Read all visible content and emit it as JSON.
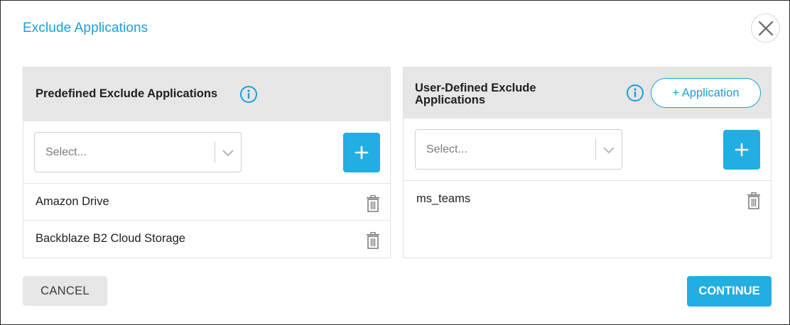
{
  "dialog": {
    "title": "Exclude Applications",
    "close_icon": "close-icon"
  },
  "predefined": {
    "title": "Predefined Exclude Applications",
    "info_icon": "info-icon",
    "select_placeholder": "Select...",
    "add_icon": "plus-icon",
    "items": [
      {
        "label": "Amazon Drive",
        "icon": "trash-icon"
      },
      {
        "label": "Backblaze B2 Cloud Storage",
        "icon": "trash-icon"
      }
    ]
  },
  "user_defined": {
    "title": "User-Defined Exclude Applications",
    "info_icon": "info-icon",
    "add_application_label": "+ Application",
    "select_placeholder": "Select...",
    "add_icon": "plus-icon",
    "items": [
      {
        "label": "ms_teams",
        "icon": "trash-icon"
      }
    ]
  },
  "footer": {
    "cancel_label": "CANCEL",
    "continue_label": "CONTINUE"
  },
  "colors": {
    "accent": "#1a9fd9",
    "button_primary": "#22aee3",
    "header_bg": "#e6e6e6"
  }
}
